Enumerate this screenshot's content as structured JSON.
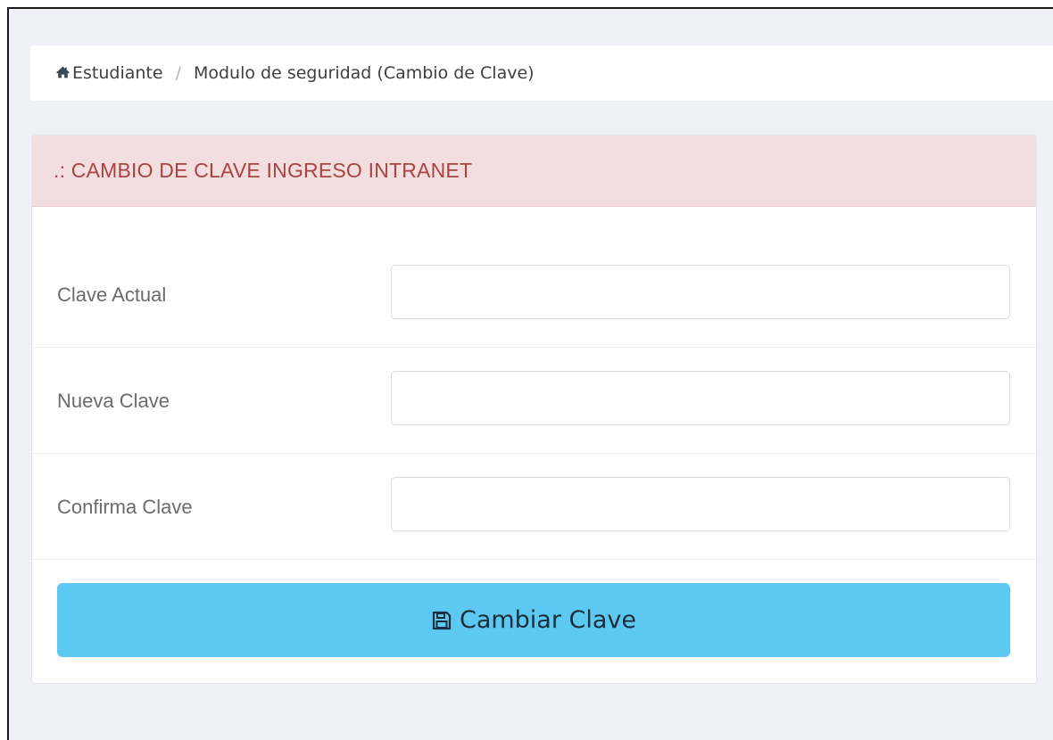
{
  "breadcrumb": {
    "home_label": "Estudiante",
    "separator": "/",
    "current": "Modulo de seguridad (Cambio de Clave)"
  },
  "panel": {
    "title": ".: CAMBIO DE CLAVE INGRESO INTRANET"
  },
  "form": {
    "fields": [
      {
        "label": "Clave Actual",
        "value": "",
        "placeholder": ""
      },
      {
        "label": "Nueva Clave",
        "value": "",
        "placeholder": ""
      },
      {
        "label": "Confirma Clave",
        "value": "",
        "placeholder": ""
      }
    ],
    "submit_label": "Cambiar Clave"
  },
  "icons": {
    "home": "home-icon",
    "save": "save-icon"
  },
  "colors": {
    "background": "#eff1f6",
    "panel_heading_bg": "#f2dede",
    "panel_heading_text": "#a94442",
    "button_bg": "#5bc9f2",
    "button_text": "#1f2d3a"
  }
}
